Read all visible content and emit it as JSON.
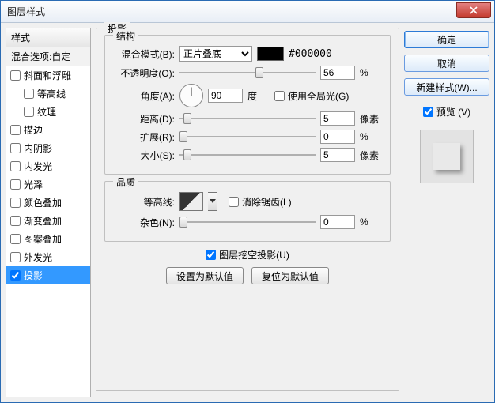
{
  "title": "图层样式",
  "left": {
    "header": "样式",
    "sub": "混合选项:自定",
    "items": [
      {
        "label": "斜面和浮雕",
        "checked": false,
        "indent": false
      },
      {
        "label": "等高线",
        "checked": false,
        "indent": true
      },
      {
        "label": "纹理",
        "checked": false,
        "indent": true
      },
      {
        "label": "描边",
        "checked": false,
        "indent": false
      },
      {
        "label": "内阴影",
        "checked": false,
        "indent": false
      },
      {
        "label": "内发光",
        "checked": false,
        "indent": false
      },
      {
        "label": "光泽",
        "checked": false,
        "indent": false
      },
      {
        "label": "颜色叠加",
        "checked": false,
        "indent": false
      },
      {
        "label": "渐变叠加",
        "checked": false,
        "indent": false
      },
      {
        "label": "图案叠加",
        "checked": false,
        "indent": false
      },
      {
        "label": "外发光",
        "checked": false,
        "indent": false
      },
      {
        "label": "投影",
        "checked": true,
        "indent": false,
        "selected": true
      }
    ]
  },
  "mid": {
    "section_title": "投影",
    "struct_title": "结构",
    "blend_label": "混合模式(B):",
    "blend_value": "正片叠底",
    "hex": "#000000",
    "opacity_label": "不透明度(O):",
    "opacity_value": "56",
    "opacity_unit": "%",
    "angle_label": "角度(A):",
    "angle_value": "90",
    "angle_unit": "度",
    "global_light": "使用全局光(G)",
    "distance_label": "距离(D):",
    "distance_value": "5",
    "distance_unit": "像素",
    "spread_label": "扩展(R):",
    "spread_value": "0",
    "spread_unit": "%",
    "size_label": "大小(S):",
    "size_value": "5",
    "size_unit": "像素",
    "quality_title": "品质",
    "contour_label": "等高线:",
    "antialias": "消除锯齿(L)",
    "noise_label": "杂色(N):",
    "noise_value": "0",
    "noise_unit": "%",
    "knockout": "图层挖空投影(U)",
    "set_default": "设置为默认值",
    "reset_default": "复位为默认值"
  },
  "right": {
    "ok": "确定",
    "cancel": "取消",
    "new_style": "新建样式(W)...",
    "preview": "预览 (V)"
  }
}
